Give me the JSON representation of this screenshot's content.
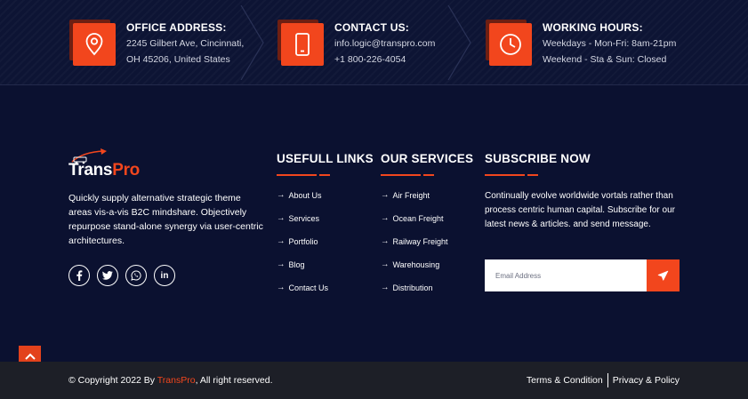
{
  "contact": {
    "office": {
      "title": "OFFICE ADDRESS:",
      "line1": "2245 Gilbert Ave, Cincinnati,",
      "line2": "OH 45206, United States",
      "icon": "map-pin-icon"
    },
    "contact_us": {
      "title": "CONTACT US:",
      "line1": "info.logic@transpro.com",
      "line2": "+1 800-226-4054",
      "icon": "phone-icon"
    },
    "hours": {
      "title": "WORKING HOURS:",
      "line1": "Weekdays - Mon-Fri: 8am-21pm",
      "line2": "Weekend - Sta & Sun: Closed",
      "icon": "clock-icon"
    }
  },
  "brand": {
    "name_part1": "Trans",
    "name_part2": "Pro",
    "about": "Quickly supply alternative strategic theme areas vis-a-vis B2C mindshare. Objectively repurpose stand-alone synergy via user-centric architectures."
  },
  "socials": [
    {
      "label": "f",
      "icon": "facebook-icon"
    },
    {
      "label": "twitter",
      "icon": "twitter-icon"
    },
    {
      "label": "whatsapp",
      "icon": "whatsapp-icon"
    },
    {
      "label": "in",
      "icon": "linkedin-icon"
    }
  ],
  "useful_links": {
    "heading": "USEFULL LINKS",
    "items": [
      "About Us",
      "Services",
      "Portfolio",
      "Blog",
      "Contact Us"
    ]
  },
  "services": {
    "heading": "OUR SERVICES",
    "items": [
      "Air Freight",
      "Ocean Freight",
      "Railway Freight",
      "Warehousing",
      "Distribution"
    ]
  },
  "subscribe": {
    "heading": "SUBSCRIBE NOW",
    "text": "Continually evolve worldwide vortals rather than process centric human capital. Subscribe for our latest news & articles. and send message.",
    "placeholder": "Email Address"
  },
  "footer": {
    "copyright_prefix": "© Copyright 2022 By ",
    "copyright_brand": "TransPro",
    "copyright_suffix": ", All right reserved.",
    "terms": "Terms & Condition",
    "privacy": "Privacy & Policy"
  },
  "colors": {
    "accent": "#f2461d",
    "background": "#0b1130",
    "bottom_bar": "#1d1f27"
  }
}
